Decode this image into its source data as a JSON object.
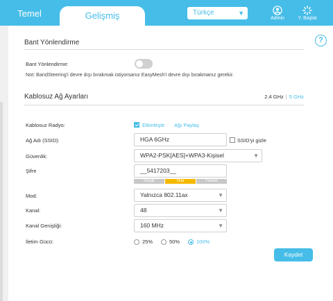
{
  "header": {
    "tab_basic": "Temel",
    "tab_advanced": "Gelişmiş",
    "language": "Türkçe",
    "admin_label": "Admin",
    "restart_label": "Y. Başlat"
  },
  "band_steering": {
    "title": "Bant Yönlendirme",
    "label": "Bant Yönlendirme:",
    "enabled": false,
    "note": "Not: BandSteering'i devre dışı bırakmak istiyorsanız EasyMesh'i devre dışı bırakmanız gerekir."
  },
  "wireless": {
    "title": "Kablosuz Ağ Ayarları",
    "band_24": "2.4 GHz",
    "band_sep": "|",
    "band_5": "5 GHz",
    "radio_label": "Kablosuz Radyo:",
    "radio_enable_label": "Etkinleştir",
    "radio_enabled": true,
    "share_network_link": "Ağı Paylaş",
    "ssid_label": "Ağ Adı (SSID):",
    "ssid_value": "HGA 6GHz",
    "hide_ssid_label": "SSID'yi gizle",
    "hide_ssid": false,
    "security_label": "Güvenlik:",
    "security_value": "WPA2-PSK[AES]+WPA3-Kişisel",
    "password_label": "Şifre",
    "password_value": "__5417203__",
    "strength_low": "Düşük",
    "strength_mid": "Orta",
    "strength_high": "Yüksek",
    "mode_label": "Mod:",
    "mode_value": "Yalnızca 802.11ax",
    "channel_label": "Kanal:",
    "channel_value": "48",
    "width_label": "Kanal Genişliği:",
    "width_value": "160 MHz",
    "power_label": "İletim Gücü:",
    "power_options": [
      "25%",
      "50%",
      "100%"
    ],
    "power_selected": "100%",
    "save_label": "Kaydet"
  },
  "colors": {
    "accent": "#46bde8",
    "strength_mid": "#f5b800",
    "strength_inactive": "#c8c8c8"
  }
}
